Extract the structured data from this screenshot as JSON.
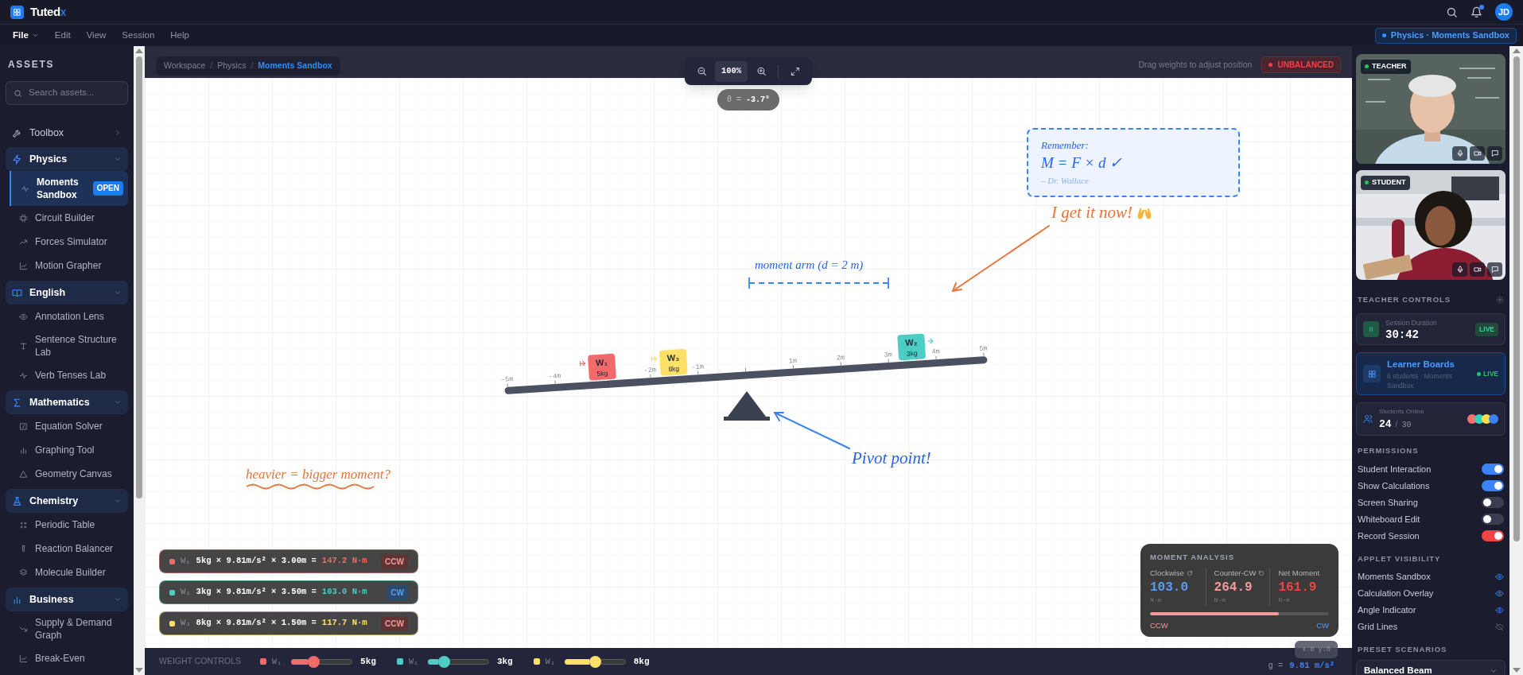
{
  "app": {
    "name": "Tuted",
    "accent": "x"
  },
  "header": {
    "notification_unread": true,
    "avatar": "JD"
  },
  "menu": [
    {
      "label": "File",
      "selected": true
    },
    {
      "label": "Edit",
      "selected": false
    },
    {
      "label": "View",
      "selected": false
    },
    {
      "label": "Session",
      "selected": false
    },
    {
      "label": "Help",
      "selected": false
    }
  ],
  "context_pill": {
    "label": "Physics · Moments Sandbox"
  },
  "sidebar": {
    "title": "ASSETS",
    "search_placeholder": "Search assets...",
    "sections": [
      {
        "label": "Toolbox",
        "expanded": false
      },
      {
        "label": "Physics",
        "expanded": true,
        "children": [
          {
            "label": "Moments Sandbox",
            "selected": true,
            "badge": "OPEN"
          },
          {
            "label": "Circuit Builder",
            "selected": false
          },
          {
            "label": "Forces Simulator",
            "selected": false
          },
          {
            "label": "Motion Grapher",
            "selected": false
          }
        ]
      },
      {
        "label": "English",
        "expanded": true,
        "children": [
          {
            "label": "Annotation Lens",
            "selected": false
          },
          {
            "label": "Sentence Structure Lab",
            "selected": false
          },
          {
            "label": "Verb Tenses Lab",
            "selected": false
          }
        ]
      },
      {
        "label": "Mathematics",
        "expanded": true,
        "children": [
          {
            "label": "Equation Solver",
            "selected": false
          },
          {
            "label": "Graphing Tool",
            "selected": false
          },
          {
            "label": "Geometry Canvas",
            "selected": false
          }
        ]
      },
      {
        "label": "Chemistry",
        "expanded": true,
        "children": [
          {
            "label": "Periodic Table",
            "selected": false
          },
          {
            "label": "Reaction Balancer",
            "selected": false
          },
          {
            "label": "Molecule Builder",
            "selected": false
          }
        ]
      },
      {
        "label": "Business",
        "expanded": true,
        "children": [
          {
            "label": "Supply & Demand Graph",
            "selected": false
          },
          {
            "label": "Break-Even",
            "selected": false
          }
        ]
      }
    ]
  },
  "canvas": {
    "breadcrumb": [
      {
        "text": "Workspace",
        "kind": "link"
      },
      {
        "text": "/",
        "kind": "separator"
      },
      {
        "text": "Physics",
        "kind": "link"
      },
      {
        "text": "/",
        "kind": "separator"
      },
      {
        "text": "Moments Sandbox",
        "kind": "current"
      }
    ],
    "zoom": "100%",
    "hint": "Drag weights to adjust position",
    "status": "UNBALANCED",
    "angle": {
      "label": "θ =",
      "value": "-3.7°"
    },
    "note": {
      "title": "Remember:",
      "formula": "M = F × d ✓",
      "author": "– Dr. Wallace"
    },
    "comment": "I get it now!",
    "dimension_label": "moment arm (d = 2 m)",
    "pivot_label": "Pivot point!",
    "question": "heavier = bigger moment?",
    "beam": {
      "ticks": [
        "-5m",
        "-4m",
        "-2m",
        "-1m",
        "1m",
        "2m",
        "3m",
        "4m",
        "5m"
      ],
      "weights": [
        {
          "label": "W₁",
          "mass": "5kg",
          "color": "#f26b6b"
        },
        {
          "label": "W₂",
          "mass": "3kg",
          "color": "#4ecdc4"
        },
        {
          "label": "W₃",
          "mass": "8kg",
          "color": "#fde068"
        }
      ]
    },
    "formula_cards": [
      {
        "label": "W₁",
        "color": "#f26b6b",
        "expression": [
          "5kg",
          "×",
          "9.81m/s²",
          "×",
          "3.00m",
          "="
        ],
        "moment": "147.2 N·m",
        "direction": "CCW",
        "kind": "ccw"
      },
      {
        "label": "W₂",
        "color": "#4ecdc4",
        "expression": [
          "3kg",
          "×",
          "9.81m/s²",
          "×",
          "3.50m",
          "="
        ],
        "moment": "103.0 N·m",
        "direction": "CW",
        "kind": "cw"
      },
      {
        "label": "W₃",
        "color": "#fde068",
        "expression": [
          "8kg",
          "×",
          "9.81m/s²",
          "×",
          "1.50m",
          "="
        ],
        "moment": "117.7 N·m",
        "direction": "CCW",
        "kind": "ccw"
      }
    ],
    "moment_analysis": {
      "title": "MOMENT ANALYSIS",
      "columns": [
        {
          "label": "Clockwise",
          "kind": "cw",
          "value": "103.0",
          "unit": "N·m",
          "color": "#5b9cf0"
        },
        {
          "label": "Counter-CW",
          "kind": "ccw",
          "value": "264.9",
          "unit": "N·m",
          "color": "#f49a9a"
        },
        {
          "label": "Net Moment",
          "kind": "net",
          "value": "161.9",
          "unit": "N·m",
          "color": "#ef4444"
        }
      ],
      "level": 0.72,
      "left_label": "CCW",
      "right_label": "CW"
    },
    "cursor": "x:0 y:0"
  },
  "weight_controls": {
    "title": "WEIGHT CONTROLS",
    "items": [
      {
        "label": "W₁",
        "color": "#f26b6b",
        "level": 0.27,
        "value": "5kg"
      },
      {
        "label": "W₂",
        "color": "#4ecdc4",
        "level": 0.17,
        "value": "3kg"
      },
      {
        "label": "W₃",
        "color": "#fde068",
        "level": 0.4,
        "value": "8kg"
      }
    ],
    "gravity": {
      "label": "g =",
      "value": "9.81 m/s²"
    }
  },
  "right_panel": {
    "videos": [
      {
        "role": "TEACHER",
        "live": true
      },
      {
        "role": "STUDENT",
        "live": true
      }
    ],
    "teacher_controls": {
      "title": "TEACHER CONTROLS",
      "session": {
        "label": "Session Duration",
        "time": "30:42",
        "badge": "LIVE"
      },
      "learner_boards": {
        "title": "Learner Boards",
        "subtitle": "6 students · Moments Sandbox",
        "badge": "LIVE"
      },
      "students_online": {
        "label": "Students Online",
        "count": "24",
        "separator": "/",
        "total": "30",
        "avatars": [
          {
            "color": "#f87171"
          },
          {
            "color": "#2dd4bf"
          },
          {
            "color": "#fde047"
          },
          {
            "color": "#3b82f6"
          }
        ]
      }
    },
    "permissions": {
      "title": "PERMISSIONS",
      "items": [
        {
          "label": "Student Interaction",
          "on": true,
          "kind": "switch"
        },
        {
          "label": "Show Calculations",
          "on": true,
          "kind": "switch"
        },
        {
          "label": "Screen Sharing",
          "on": false,
          "kind": "switch"
        },
        {
          "label": "Whiteboard Edit",
          "on": false,
          "kind": "switch"
        },
        {
          "label": "Record Session",
          "on": true,
          "kind": "record"
        }
      ]
    },
    "applet_visibility": {
      "title": "APPLET VISIBILITY",
      "items": [
        {
          "label": "Moments Sandbox",
          "visible": true
        },
        {
          "label": "Calculation Overlay",
          "visible": true
        },
        {
          "label": "Angle Indicator",
          "visible": true
        },
        {
          "label": "Grid Lines",
          "visible": false
        }
      ]
    },
    "preset_scenarios": {
      "title": "PRESET SCENARIOS",
      "value": "Balanced Beam"
    }
  }
}
